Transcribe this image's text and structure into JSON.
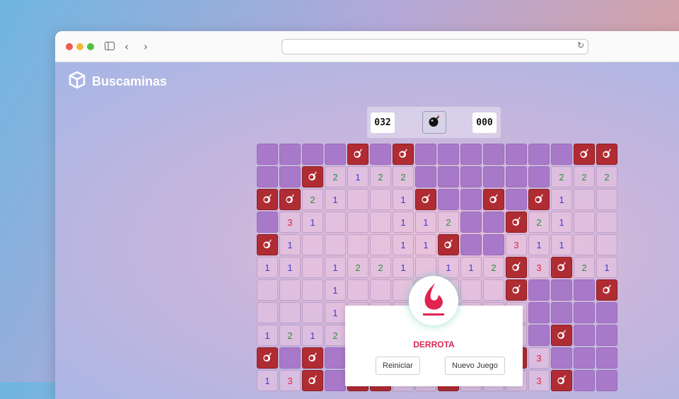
{
  "app": {
    "name": "Buscaminas"
  },
  "browser": {
    "url": ""
  },
  "hud": {
    "mines_left": "032",
    "timer": "000"
  },
  "board": {
    "cols": 16,
    "rows": [
      "HHHHMHMHHHHHHHMM",
      "HHM2122HHHHHH222",
      "MM21..1MHHMHM1..",
      "H31...112HHM21..",
      "M1....11MHH311.",
      "11.1221.112M3M21",
      "...1.......MHHHM",
      "...1........HHHH",
      "1212........HMHH",
      "MHMHMM211.1M3HHH",
      "13MHMM1.M1113MHH"
    ]
  },
  "modal": {
    "title": "DERROTA",
    "restart_label": "Reiniciar",
    "new_game_label": "Nuevo Juego"
  },
  "colors": {
    "hidden": "#a979c9",
    "mine": "#b02c33",
    "accent": "#d6284e"
  }
}
